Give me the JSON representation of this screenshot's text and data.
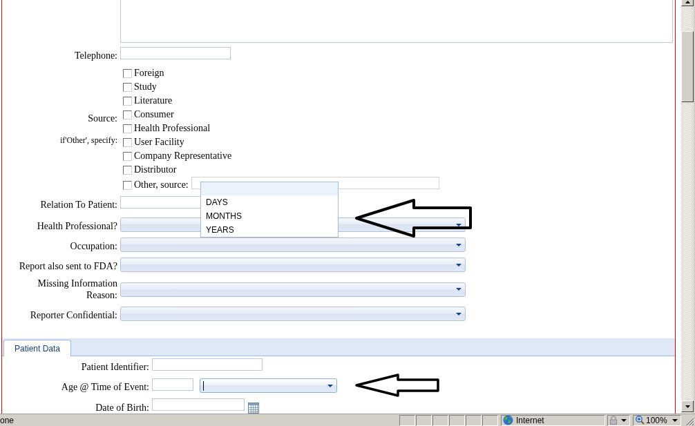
{
  "reporter_fields": [
    {
      "kind": "text",
      "label": "Telephone:"
    },
    {
      "kind": "checkbox_group",
      "label": "Source:",
      "note": "if'Other', specify:",
      "options": [
        {
          "kind": "checkbox",
          "label": "Foreign",
          "checked": false
        },
        {
          "kind": "checkbox",
          "label": "Study",
          "checked": false
        },
        {
          "kind": "checkbox",
          "label": "Literature",
          "checked": false
        },
        {
          "kind": "checkbox",
          "label": "Consumer",
          "checked": false
        },
        {
          "kind": "checkbox",
          "label": "Health Professional",
          "checked": false
        },
        {
          "kind": "checkbox",
          "label": "User Facility",
          "checked": false
        },
        {
          "kind": "checkbox",
          "label": "Company Representative",
          "checked": false
        },
        {
          "kind": "checkbox",
          "label": "Distributor",
          "checked": false
        },
        {
          "kind": "checkbox_field",
          "label": "Other, source:",
          "checked": false
        }
      ]
    },
    {
      "kind": "text",
      "label": "Relation To Patient:"
    },
    {
      "kind": "select",
      "label": "Health Professional?"
    },
    {
      "kind": "select",
      "label": "Occupation:"
    },
    {
      "kind": "select",
      "label": "Report also sent to FDA?"
    },
    {
      "kind": "select",
      "label": "Missing Information Reason:"
    },
    {
      "kind": "select",
      "label": "Reporter Confidential:"
    }
  ],
  "tabs": [
    {
      "label": "Patient Data",
      "selected": true
    }
  ],
  "patient_fields": [
    {
      "kind": "text",
      "label": "Patient Identifier:"
    },
    {
      "kind": "age",
      "label": "Age @ Time of Event:",
      "unit_focused": true
    },
    {
      "kind": "date",
      "label": "Date of Birth:"
    }
  ],
  "dropdown_list": {
    "blank_highlighted": true,
    "options": [
      {
        "label": "DAYS",
        "selected": false
      },
      {
        "label": "MONTHS",
        "selected": false
      },
      {
        "label": "YEARS",
        "selected": false
      }
    ]
  },
  "status_bar": {
    "message": "one",
    "zone": "Internet",
    "zoom": "100%"
  }
}
